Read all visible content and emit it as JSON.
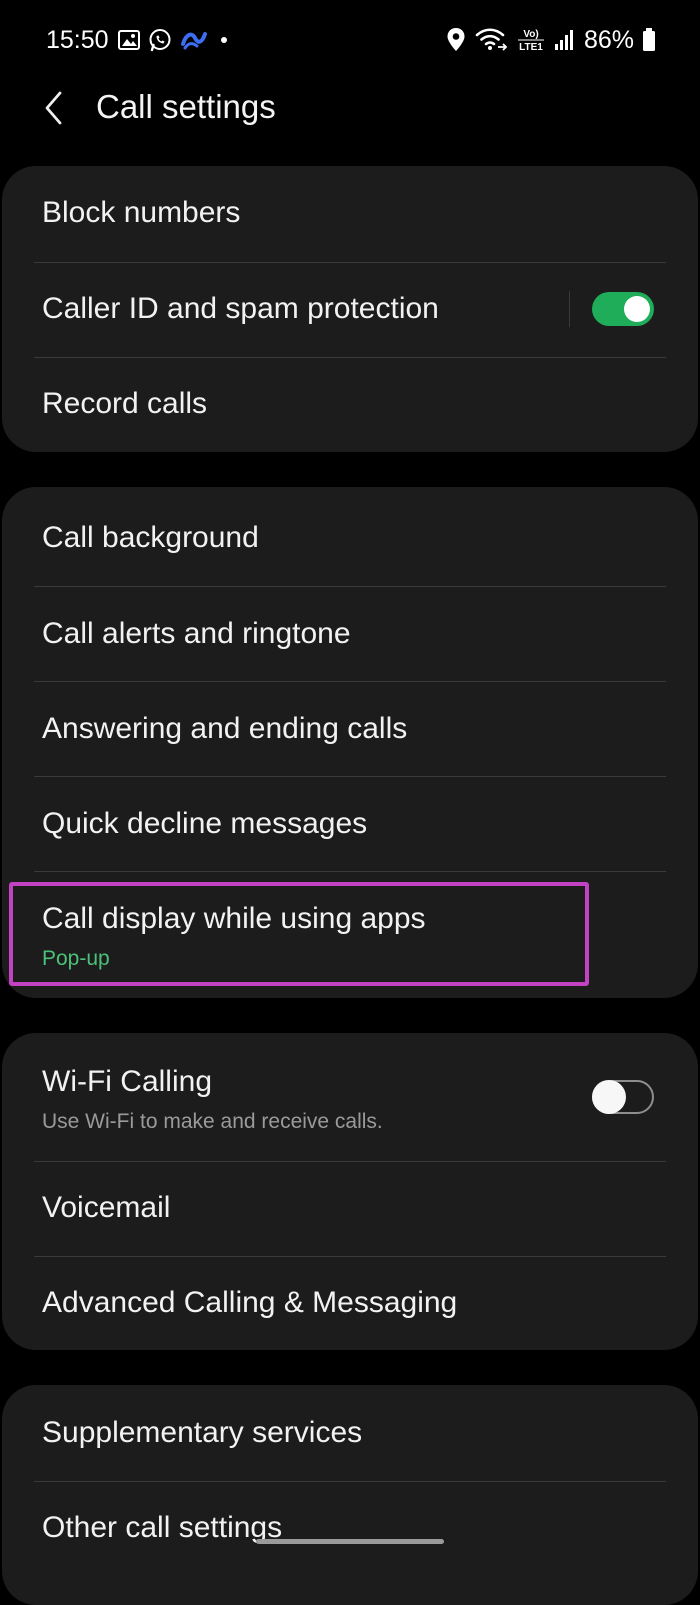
{
  "status_bar": {
    "time": "15:50",
    "battery": "86%",
    "network_label_top": "Vo)",
    "network_label_bottom": "LTE1",
    "icons": [
      "gallery-icon",
      "whatsapp-icon",
      "app-notification-icon",
      "dot-icon",
      "location-icon",
      "wifi-calling-icon",
      "signal-icon",
      "battery-icon"
    ]
  },
  "header": {
    "title": "Call settings",
    "back_icon": "chevron-left-icon"
  },
  "colors": {
    "background": "#000000",
    "card": "#1c1c1c",
    "accent_green": "#1fad5a",
    "subtext_green": "#4cc179",
    "highlight": "#c342c3"
  },
  "groups": [
    {
      "items": [
        {
          "label": "Block numbers"
        },
        {
          "label": "Caller ID and spam protection",
          "toggle": "on"
        },
        {
          "label": "Record calls"
        }
      ]
    },
    {
      "items": [
        {
          "label": "Call background"
        },
        {
          "label": "Call alerts and ringtone"
        },
        {
          "label": "Answering and ending calls"
        },
        {
          "label": "Quick decline messages"
        },
        {
          "label": "Call display while using apps",
          "value": "Pop-up"
        }
      ]
    },
    {
      "items": [
        {
          "label": "Wi-Fi Calling",
          "summary": "Use Wi-Fi to make and receive calls.",
          "toggle": "off"
        },
        {
          "label": "Voicemail"
        },
        {
          "label": "Advanced Calling & Messaging"
        }
      ]
    },
    {
      "items": [
        {
          "label": "Supplementary services"
        },
        {
          "label": "Other call settings"
        }
      ]
    }
  ]
}
